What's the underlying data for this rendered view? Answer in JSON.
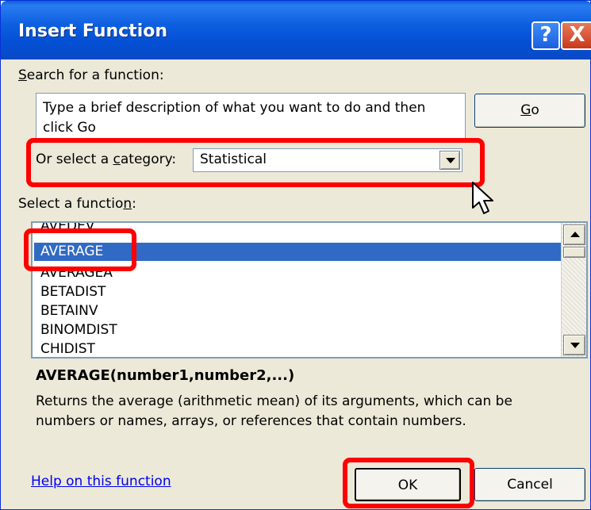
{
  "window": {
    "title": "Insert Function"
  },
  "titlebar_buttons": {
    "help": "?",
    "close": "X"
  },
  "search": {
    "label_prefix": "",
    "label_accel": "S",
    "label_rest": "earch for a function:",
    "value": "Type a brief description of what you want to do and then click Go",
    "go_button": {
      "accel": "G",
      "rest": "o"
    }
  },
  "category": {
    "label_prefix": "Or select a ",
    "label_accel": "c",
    "label_rest": "ategory:",
    "selected": "Statistical"
  },
  "function_list": {
    "label_prefix": "Select a functio",
    "label_accel": "n",
    "label_rest": ":",
    "items": [
      "AVEDEV",
      "AVERAGE",
      "AVERAGEA",
      "BETADIST",
      "BETAINV",
      "BINOMDIST",
      "CHIDIST"
    ],
    "selected": "AVERAGE"
  },
  "details": {
    "signature": "AVERAGE(number1,number2,...)",
    "description": "Returns the average (arithmetic mean) of its arguments, which can be numbers or names, arrays, or references that contain numbers."
  },
  "footer": {
    "help_link": "Help on this function",
    "ok": "OK",
    "cancel": "Cancel"
  },
  "colors": {
    "title_bar": "#0a5fd8",
    "dialog_bg": "#ece9d8",
    "selection": "#316ac5",
    "highlight_annotation": "#ff0000",
    "link": "#0000ee"
  }
}
